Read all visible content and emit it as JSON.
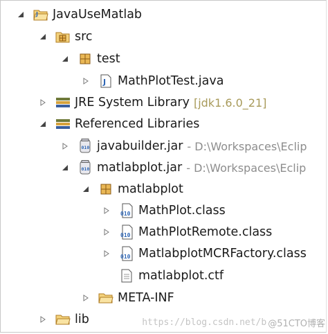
{
  "tree": {
    "project": {
      "label": "JavaUseMatlab"
    },
    "src": {
      "label": "src",
      "package": {
        "label": "test",
        "file": {
          "label": "MathPlotTest.java"
        }
      }
    },
    "jre": {
      "label": "JRE System Library",
      "decoration": "[jdk1.6.0_21]"
    },
    "referenced": {
      "label": "Referenced Libraries",
      "jar1": {
        "label": "javabuilder.jar",
        "path": "- D:\\Workspaces\\Eclip"
      },
      "jar2": {
        "label": "matlabplot.jar",
        "path": "- D:\\Workspaces\\Eclip",
        "package": {
          "label": "matlabplot",
          "items": [
            "MathPlot.class",
            "MathPlotRemote.class",
            "MatlabplotMCRFactory.class",
            "matlabplot.ctf"
          ]
        },
        "metainf": {
          "label": "META-INF"
        }
      }
    },
    "lib": {
      "label": "lib"
    }
  },
  "watermark": {
    "url": "https://blog.csdn.net/b",
    "badge": "@51CTO博客"
  },
  "colors": {
    "folder": "#e8b54a",
    "package": "#c88a32",
    "book": "#6f7a3a",
    "class_blue": "#2e66b5",
    "arrow": "#4a4a4a"
  }
}
